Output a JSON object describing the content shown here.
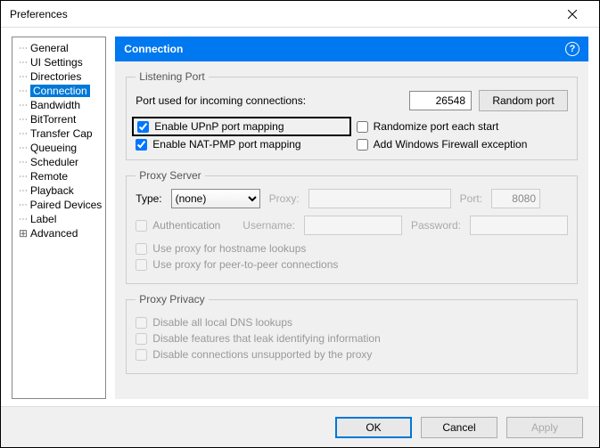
{
  "window": {
    "title": "Preferences"
  },
  "sidebar": {
    "items": [
      {
        "label": "General"
      },
      {
        "label": "UI Settings"
      },
      {
        "label": "Directories"
      },
      {
        "label": "Connection",
        "selected": true
      },
      {
        "label": "Bandwidth"
      },
      {
        "label": "BitTorrent"
      },
      {
        "label": "Transfer Cap"
      },
      {
        "label": "Queueing"
      },
      {
        "label": "Scheduler"
      },
      {
        "label": "Remote"
      },
      {
        "label": "Playback"
      },
      {
        "label": "Paired Devices"
      },
      {
        "label": "Label"
      },
      {
        "label": "Advanced",
        "expandable": true
      }
    ]
  },
  "header": {
    "title": "Connection"
  },
  "listening_port": {
    "legend": "Listening Port",
    "port_label": "Port used for incoming connections:",
    "port_value": "26548",
    "random_label": "Random port",
    "upnp_label": "Enable UPnP port mapping",
    "natpmp_label": "Enable NAT-PMP port mapping",
    "randomize_label": "Randomize port each start",
    "firewall_label": "Add Windows Firewall exception"
  },
  "proxy": {
    "legend": "Proxy Server",
    "type_label": "Type:",
    "type_value": "(none)",
    "proxy_label": "Proxy:",
    "port_label": "Port:",
    "port_value": "8080",
    "auth_label": "Authentication",
    "user_label": "Username:",
    "pass_label": "Password:",
    "hostname_label": "Use proxy for hostname lookups",
    "p2p_label": "Use proxy for peer-to-peer connections"
  },
  "privacy": {
    "legend": "Proxy Privacy",
    "dns_label": "Disable all local DNS lookups",
    "leak_label": "Disable features that leak identifying information",
    "unsupported_label": "Disable connections unsupported by the proxy"
  },
  "footer": {
    "ok": "OK",
    "cancel": "Cancel",
    "apply": "Apply"
  }
}
